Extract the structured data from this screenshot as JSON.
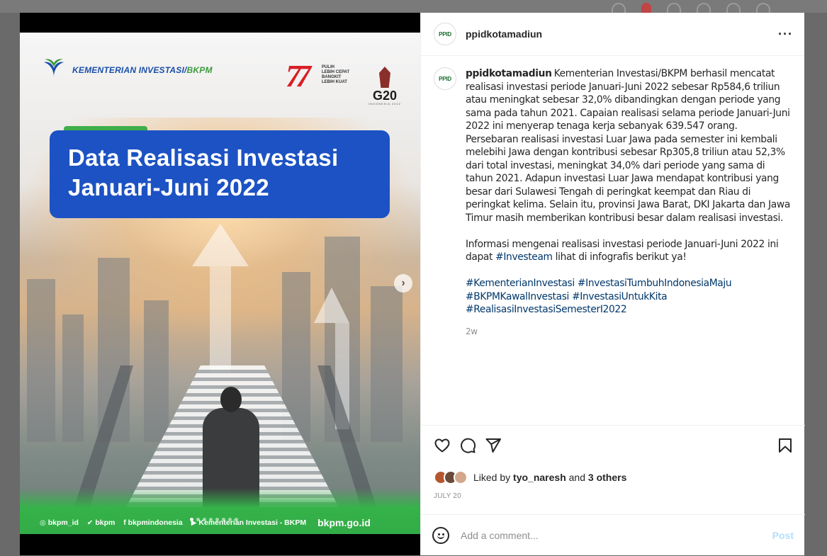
{
  "post": {
    "username": "ppidkotamadiun",
    "avatar_text": "PPID",
    "more_icon": "more-horizontal-icon",
    "caption_paragraphs": [
      "Kementerian Investasi/BKPM berhasil mencatat realisasi investasi periode Januari-Juni 2022 sebesar Rp584,6 triliun atau meningkat sebesar 32,0% dibandingkan dengan periode yang sama pada tahun 2021. Capaian realisasi selama periode Januari-Juni 2022 ini menyerap tenaga kerja sebanyak 639.547 orang.",
      "Persebaran realisasi investasi Luar Jawa pada semester ini kembali melebihi Jawa dengan kontribusi sebesar Rp305,8 triliun atau 52,3% dari total investasi, meningkat 34,0% dari periode yang sama di tahun 2021. Adapun investasi Luar Jawa mendapat kontribusi yang besar dari Sulawesi Tengah di peringkat keempat dan Riau di peringkat kelima. Selain itu, provinsi Jawa Barat, DKI Jakarta dan Jawa Timur masih memberikan kontribusi besar dalam realisasi investasi."
    ],
    "info_text_before": "Informasi mengenai realisasi investasi periode Januari-Juni 2022 ini dapat ",
    "info_tag": "#Investeam",
    "info_text_after": " lihat di infografis berikut ya!",
    "hashtags": [
      "#KementerianInvestasi",
      "#InvestasiTumbuhIndonesiaMaju",
      "#BKPMKawalInvestasi",
      "#InvestasiUntukKita",
      "#RealisasiInvestasiSemesterI2022"
    ],
    "time_ago": "2w",
    "liked_by_prefix": "Liked by ",
    "liked_by_user": "tyo_naresh",
    "liked_by_mid": " and ",
    "liked_by_others": "3 others",
    "date": "JULY 20",
    "comment_placeholder": "Add a comment...",
    "post_label": "Post"
  },
  "poster": {
    "ministry_name": "KEMENTERIAN INVESTASI/",
    "ministry_abbr": "BKPM",
    "hut_number": "77",
    "hut_tagline": [
      "PULIH",
      "LEBIH CEPAT",
      "BANGKIT",
      "LEBIH KUAT"
    ],
    "g20_text": "G20",
    "g20_sub": "INDONESIA 2022",
    "title_line1": "Data Realisasi Investasi",
    "title_line2": "Januari-Juni 2022",
    "social": [
      {
        "icon": "instagram-icon",
        "glyph": "◎",
        "label": "bkpm_id"
      },
      {
        "icon": "twitter-icon",
        "glyph": "✔",
        "label": "bkpm"
      },
      {
        "icon": "facebook-icon",
        "glyph": "f",
        "label": "bkpmindonesia"
      },
      {
        "icon": "youtube-icon",
        "glyph": "▶",
        "label": "Kementerian Investasi - BKPM"
      }
    ],
    "website": "bkpm.go.id",
    "carousel_total": 8,
    "carousel_active": 1
  },
  "colors": {
    "title_box": "#1c52c3",
    "footer_green": "#2ea744",
    "link": "#00376b",
    "muted": "#8e8e8e",
    "post_disabled": "#b2dffc"
  }
}
